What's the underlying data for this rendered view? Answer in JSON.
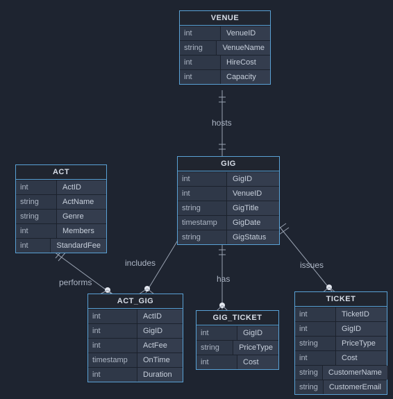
{
  "entities": {
    "venue": {
      "title": "VENUE",
      "rows": [
        {
          "type": "int",
          "name": "VenueID"
        },
        {
          "type": "string",
          "name": "VenueName"
        },
        {
          "type": "int",
          "name": "HireCost"
        },
        {
          "type": "int",
          "name": "Capacity"
        }
      ]
    },
    "gig": {
      "title": "GIG",
      "rows": [
        {
          "type": "int",
          "name": "GigID"
        },
        {
          "type": "int",
          "name": "VenueID"
        },
        {
          "type": "string",
          "name": "GigTitle"
        },
        {
          "type": "timestamp",
          "name": "GigDate"
        },
        {
          "type": "string",
          "name": "GigStatus"
        }
      ]
    },
    "act": {
      "title": "ACT",
      "rows": [
        {
          "type": "int",
          "name": "ActID"
        },
        {
          "type": "string",
          "name": "ActName"
        },
        {
          "type": "string",
          "name": "Genre"
        },
        {
          "type": "int",
          "name": "Members"
        },
        {
          "type": "int",
          "name": "StandardFee"
        }
      ]
    },
    "act_gig": {
      "title": "ACT_GIG",
      "rows": [
        {
          "type": "int",
          "name": "ActID"
        },
        {
          "type": "int",
          "name": "GigID"
        },
        {
          "type": "int",
          "name": "ActFee"
        },
        {
          "type": "timestamp",
          "name": "OnTime"
        },
        {
          "type": "int",
          "name": "Duration"
        }
      ]
    },
    "gig_ticket": {
      "title": "GIG_TICKET",
      "rows": [
        {
          "type": "int",
          "name": "GigID"
        },
        {
          "type": "string",
          "name": "PriceType"
        },
        {
          "type": "int",
          "name": "Cost"
        }
      ]
    },
    "ticket": {
      "title": "TICKET",
      "rows": [
        {
          "type": "int",
          "name": "TicketID"
        },
        {
          "type": "int",
          "name": "GigID"
        },
        {
          "type": "string",
          "name": "PriceType"
        },
        {
          "type": "int",
          "name": "Cost"
        },
        {
          "type": "string",
          "name": "CustomerName"
        },
        {
          "type": "string",
          "name": "CustomerEmail"
        }
      ]
    }
  },
  "relations": {
    "hosts": "hosts",
    "includes": "includes",
    "performs": "performs",
    "has": "has",
    "issues": "issues"
  }
}
